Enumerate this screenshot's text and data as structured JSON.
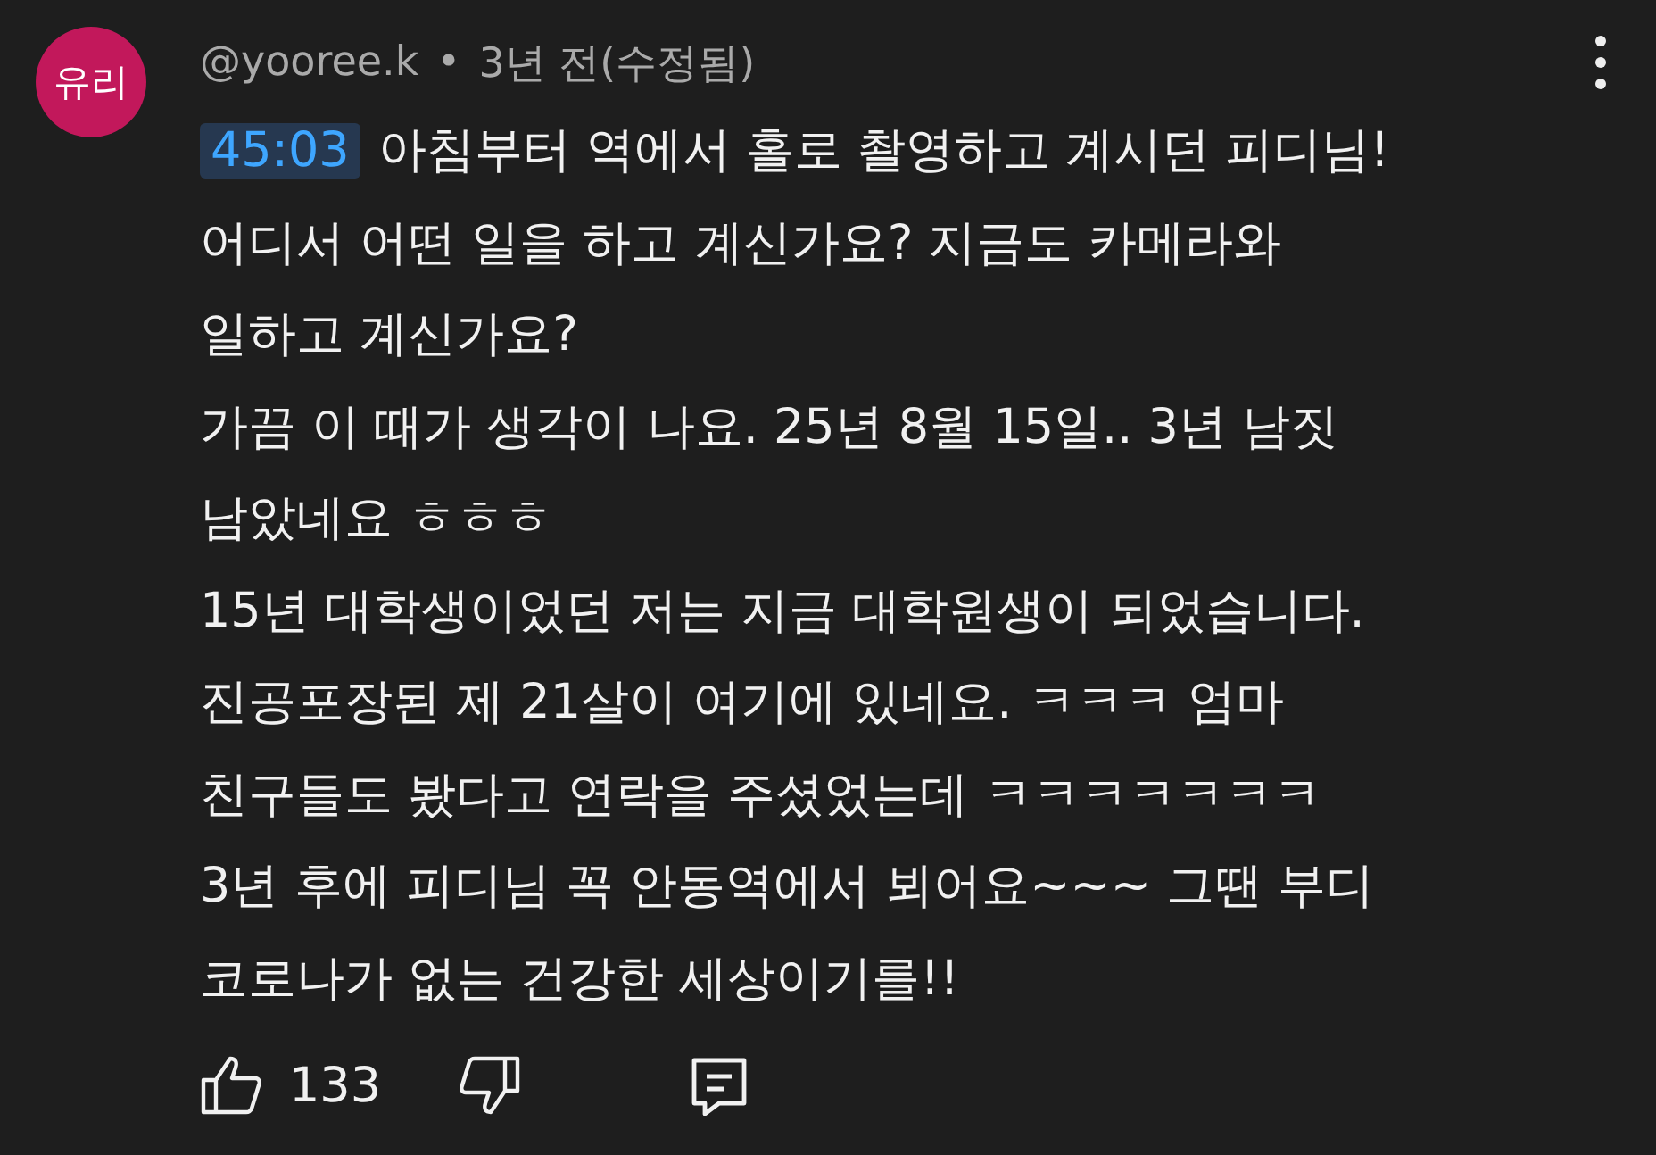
{
  "comment": {
    "avatar_text": "유리",
    "author": "@yooree.k",
    "separator": "•",
    "time": "3년 전(수정됨)",
    "timestamp": "45:03",
    "lines": [
      "아침부터 역에서 홀로 촬영하고 계시던 피디님!",
      "어디서 어떤 일을 하고 계신가요?  지금도 카메라와",
      "일하고 계신가요?",
      "가끔 이 때가 생각이 나요. 25년 8월 15일.. 3년 남짓",
      "남았네요 ㅎㅎㅎ",
      "15년 대학생이었던 저는 지금 대학원생이 되었습니다.",
      "진공포장된 제 21살이 여기에 있네요. ㅋㅋㅋ 엄마",
      "친구들도 봤다고 연락을 주셨었는데 ㅋㅋㅋㅋㅋㅋㅋ",
      "3년 후에 피디님 꼭 안동역에서 뵈어요~~~ 그땐 부디",
      "코로나가 없는 건강한 세상이기를!!"
    ],
    "likes": "133"
  }
}
